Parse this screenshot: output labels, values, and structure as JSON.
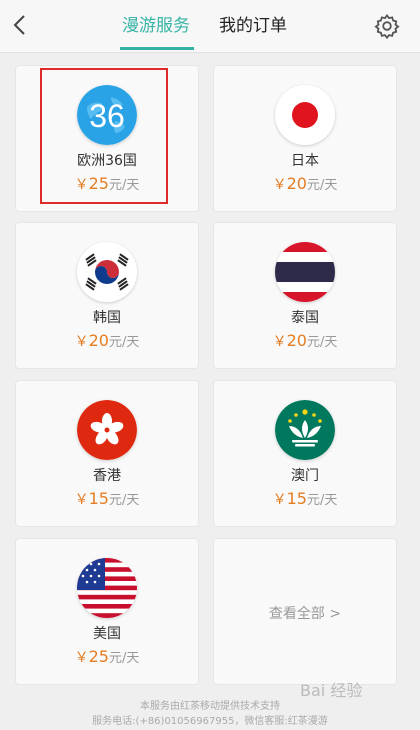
{
  "header": {
    "tabs": [
      "漫游服务",
      "我的订单"
    ]
  },
  "cards": [
    {
      "name": "欧洲36国",
      "badge": "36",
      "currency": "￥",
      "price": "25",
      "unit": "元/天"
    },
    {
      "name": "日本",
      "currency": "￥",
      "price": "20",
      "unit": "元/天"
    },
    {
      "name": "韩国",
      "currency": "￥",
      "price": "20",
      "unit": "元/天"
    },
    {
      "name": "泰国",
      "currency": "￥",
      "price": "20",
      "unit": "元/天"
    },
    {
      "name": "香港",
      "currency": "￥",
      "price": "15",
      "unit": "元/天"
    },
    {
      "name": "澳门",
      "currency": "￥",
      "price": "15",
      "unit": "元/天"
    },
    {
      "name": "美国",
      "currency": "￥",
      "price": "25",
      "unit": "元/天"
    }
  ],
  "view_all": "查看全部 >",
  "footer": {
    "line1": "本服务由红茶移动提供技术支持",
    "line2": "服务电话:(+86)01056967955，微信客服:红茶漫游"
  },
  "watermark": "Bai 经验",
  "colors": {
    "accent": "#35b3a5",
    "price": "#e57d23",
    "highlight": "#e02a2a"
  }
}
